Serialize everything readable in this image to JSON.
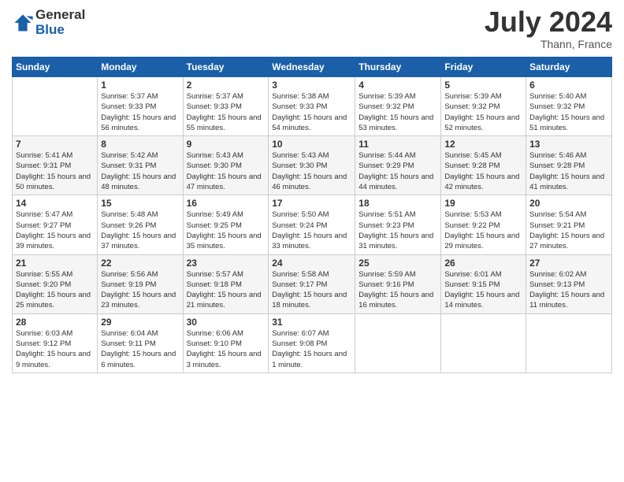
{
  "header": {
    "logo_line1": "General",
    "logo_line2": "Blue",
    "month_title": "July 2024",
    "location": "Thann, France"
  },
  "days_of_week": [
    "Sunday",
    "Monday",
    "Tuesday",
    "Wednesday",
    "Thursday",
    "Friday",
    "Saturday"
  ],
  "weeks": [
    [
      {
        "day": "",
        "sunrise": "",
        "sunset": "",
        "daylight": ""
      },
      {
        "day": "1",
        "sunrise": "Sunrise: 5:37 AM",
        "sunset": "Sunset: 9:33 PM",
        "daylight": "Daylight: 15 hours and 56 minutes."
      },
      {
        "day": "2",
        "sunrise": "Sunrise: 5:37 AM",
        "sunset": "Sunset: 9:33 PM",
        "daylight": "Daylight: 15 hours and 55 minutes."
      },
      {
        "day": "3",
        "sunrise": "Sunrise: 5:38 AM",
        "sunset": "Sunset: 9:33 PM",
        "daylight": "Daylight: 15 hours and 54 minutes."
      },
      {
        "day": "4",
        "sunrise": "Sunrise: 5:39 AM",
        "sunset": "Sunset: 9:32 PM",
        "daylight": "Daylight: 15 hours and 53 minutes."
      },
      {
        "day": "5",
        "sunrise": "Sunrise: 5:39 AM",
        "sunset": "Sunset: 9:32 PM",
        "daylight": "Daylight: 15 hours and 52 minutes."
      },
      {
        "day": "6",
        "sunrise": "Sunrise: 5:40 AM",
        "sunset": "Sunset: 9:32 PM",
        "daylight": "Daylight: 15 hours and 51 minutes."
      }
    ],
    [
      {
        "day": "7",
        "sunrise": "Sunrise: 5:41 AM",
        "sunset": "Sunset: 9:31 PM",
        "daylight": "Daylight: 15 hours and 50 minutes."
      },
      {
        "day": "8",
        "sunrise": "Sunrise: 5:42 AM",
        "sunset": "Sunset: 9:31 PM",
        "daylight": "Daylight: 15 hours and 48 minutes."
      },
      {
        "day": "9",
        "sunrise": "Sunrise: 5:43 AM",
        "sunset": "Sunset: 9:30 PM",
        "daylight": "Daylight: 15 hours and 47 minutes."
      },
      {
        "day": "10",
        "sunrise": "Sunrise: 5:43 AM",
        "sunset": "Sunset: 9:30 PM",
        "daylight": "Daylight: 15 hours and 46 minutes."
      },
      {
        "day": "11",
        "sunrise": "Sunrise: 5:44 AM",
        "sunset": "Sunset: 9:29 PM",
        "daylight": "Daylight: 15 hours and 44 minutes."
      },
      {
        "day": "12",
        "sunrise": "Sunrise: 5:45 AM",
        "sunset": "Sunset: 9:28 PM",
        "daylight": "Daylight: 15 hours and 42 minutes."
      },
      {
        "day": "13",
        "sunrise": "Sunrise: 5:46 AM",
        "sunset": "Sunset: 9:28 PM",
        "daylight": "Daylight: 15 hours and 41 minutes."
      }
    ],
    [
      {
        "day": "14",
        "sunrise": "Sunrise: 5:47 AM",
        "sunset": "Sunset: 9:27 PM",
        "daylight": "Daylight: 15 hours and 39 minutes."
      },
      {
        "day": "15",
        "sunrise": "Sunrise: 5:48 AM",
        "sunset": "Sunset: 9:26 PM",
        "daylight": "Daylight: 15 hours and 37 minutes."
      },
      {
        "day": "16",
        "sunrise": "Sunrise: 5:49 AM",
        "sunset": "Sunset: 9:25 PM",
        "daylight": "Daylight: 15 hours and 35 minutes."
      },
      {
        "day": "17",
        "sunrise": "Sunrise: 5:50 AM",
        "sunset": "Sunset: 9:24 PM",
        "daylight": "Daylight: 15 hours and 33 minutes."
      },
      {
        "day": "18",
        "sunrise": "Sunrise: 5:51 AM",
        "sunset": "Sunset: 9:23 PM",
        "daylight": "Daylight: 15 hours and 31 minutes."
      },
      {
        "day": "19",
        "sunrise": "Sunrise: 5:53 AM",
        "sunset": "Sunset: 9:22 PM",
        "daylight": "Daylight: 15 hours and 29 minutes."
      },
      {
        "day": "20",
        "sunrise": "Sunrise: 5:54 AM",
        "sunset": "Sunset: 9:21 PM",
        "daylight": "Daylight: 15 hours and 27 minutes."
      }
    ],
    [
      {
        "day": "21",
        "sunrise": "Sunrise: 5:55 AM",
        "sunset": "Sunset: 9:20 PM",
        "daylight": "Daylight: 15 hours and 25 minutes."
      },
      {
        "day": "22",
        "sunrise": "Sunrise: 5:56 AM",
        "sunset": "Sunset: 9:19 PM",
        "daylight": "Daylight: 15 hours and 23 minutes."
      },
      {
        "day": "23",
        "sunrise": "Sunrise: 5:57 AM",
        "sunset": "Sunset: 9:18 PM",
        "daylight": "Daylight: 15 hours and 21 minutes."
      },
      {
        "day": "24",
        "sunrise": "Sunrise: 5:58 AM",
        "sunset": "Sunset: 9:17 PM",
        "daylight": "Daylight: 15 hours and 18 minutes."
      },
      {
        "day": "25",
        "sunrise": "Sunrise: 5:59 AM",
        "sunset": "Sunset: 9:16 PM",
        "daylight": "Daylight: 15 hours and 16 minutes."
      },
      {
        "day": "26",
        "sunrise": "Sunrise: 6:01 AM",
        "sunset": "Sunset: 9:15 PM",
        "daylight": "Daylight: 15 hours and 14 minutes."
      },
      {
        "day": "27",
        "sunrise": "Sunrise: 6:02 AM",
        "sunset": "Sunset: 9:13 PM",
        "daylight": "Daylight: 15 hours and 11 minutes."
      }
    ],
    [
      {
        "day": "28",
        "sunrise": "Sunrise: 6:03 AM",
        "sunset": "Sunset: 9:12 PM",
        "daylight": "Daylight: 15 hours and 9 minutes."
      },
      {
        "day": "29",
        "sunrise": "Sunrise: 6:04 AM",
        "sunset": "Sunset: 9:11 PM",
        "daylight": "Daylight: 15 hours and 6 minutes."
      },
      {
        "day": "30",
        "sunrise": "Sunrise: 6:06 AM",
        "sunset": "Sunset: 9:10 PM",
        "daylight": "Daylight: 15 hours and 3 minutes."
      },
      {
        "day": "31",
        "sunrise": "Sunrise: 6:07 AM",
        "sunset": "Sunset: 9:08 PM",
        "daylight": "Daylight: 15 hours and 1 minute."
      },
      {
        "day": "",
        "sunrise": "",
        "sunset": "",
        "daylight": ""
      },
      {
        "day": "",
        "sunrise": "",
        "sunset": "",
        "daylight": ""
      },
      {
        "day": "",
        "sunrise": "",
        "sunset": "",
        "daylight": ""
      }
    ]
  ]
}
